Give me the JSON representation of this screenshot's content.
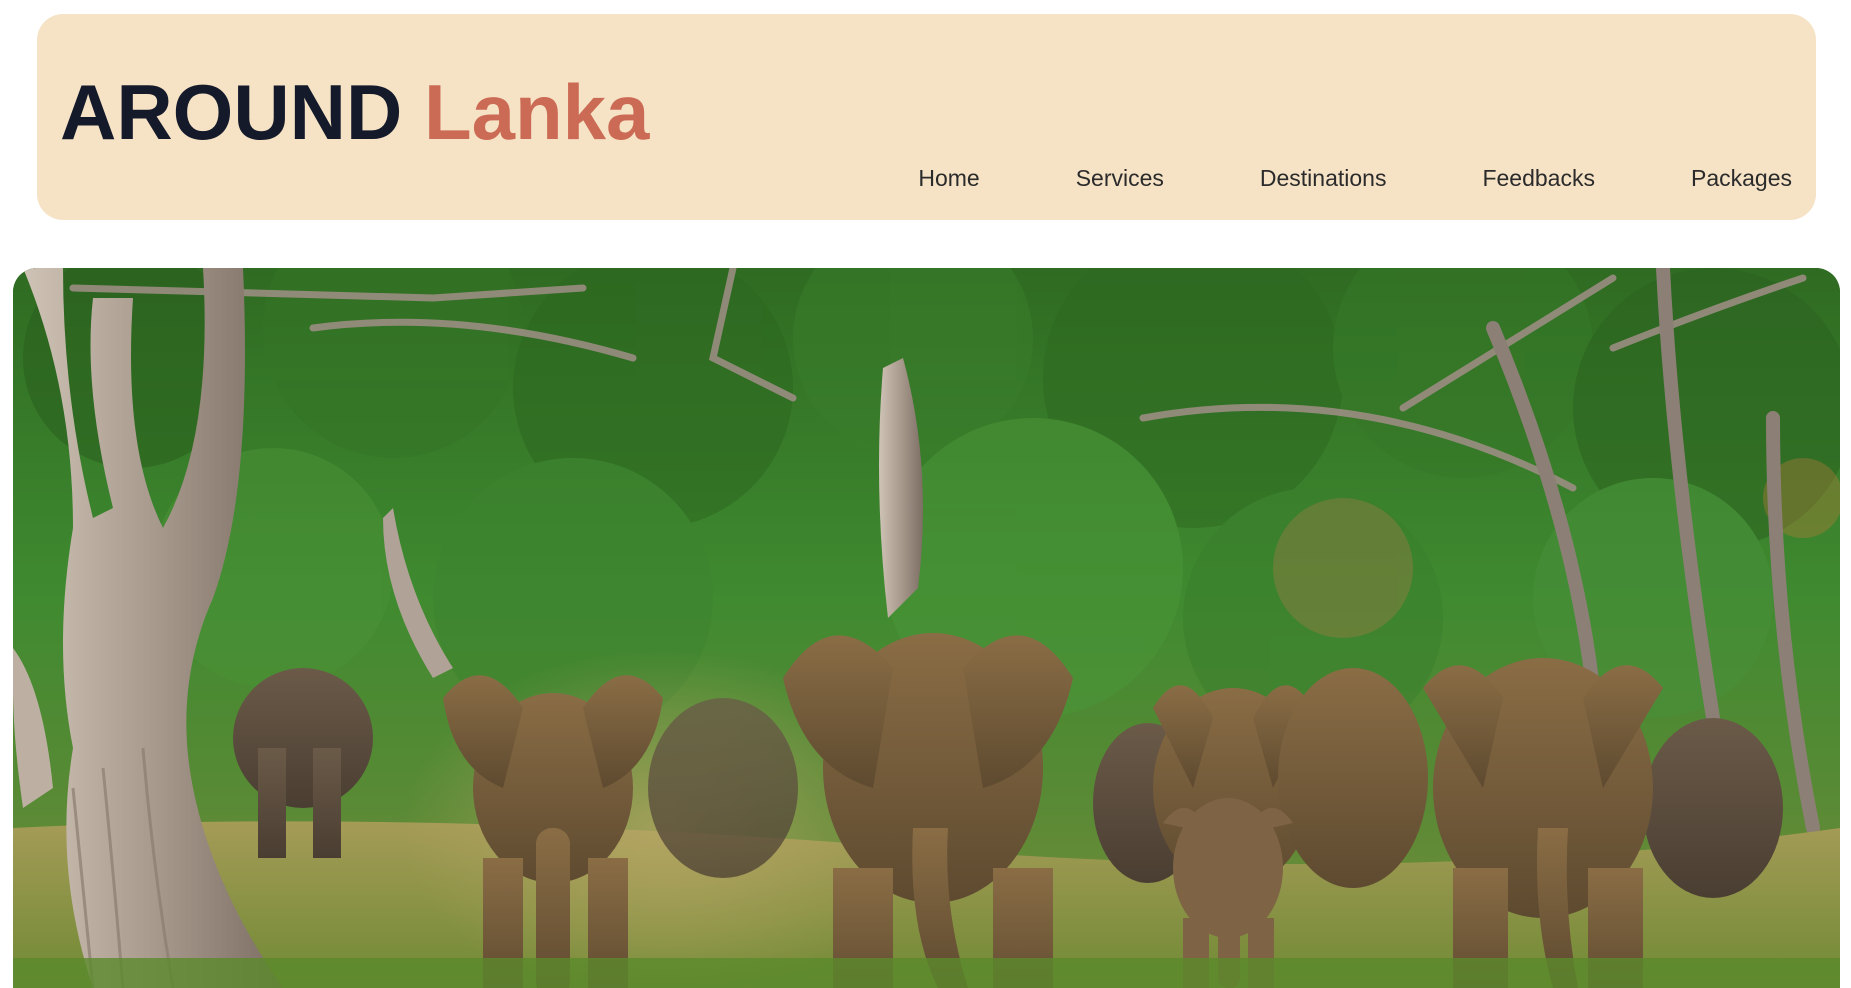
{
  "brand": {
    "word1": "AROUND",
    "word2": "Lanka",
    "colors": {
      "dark": "#151a2b",
      "accent": "#cc6b55",
      "header_bg": "#f6e3c6"
    }
  },
  "nav": {
    "items": [
      {
        "label": "Home"
      },
      {
        "label": "Services"
      },
      {
        "label": "Destinations"
      },
      {
        "label": "Feedbacks"
      },
      {
        "label": "Packages"
      }
    ]
  },
  "hero": {
    "image_subject": "elephant-herd-forest-photo"
  }
}
